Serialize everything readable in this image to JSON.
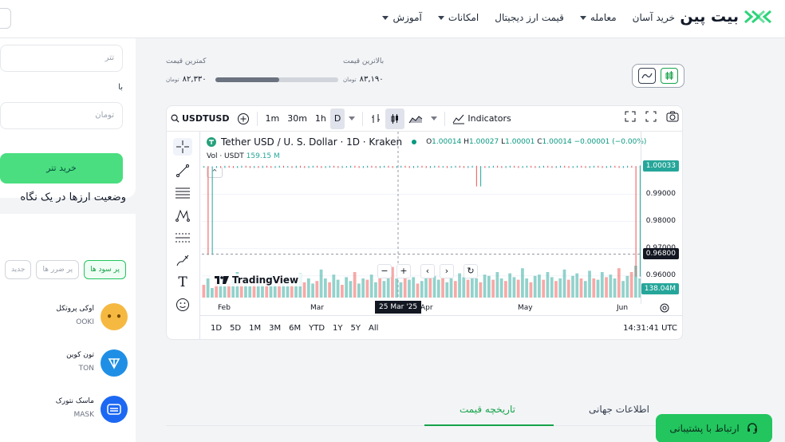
{
  "brand": {
    "name": "بیت پین",
    "logo_color": "#2dd47a"
  },
  "nav": {
    "items": [
      {
        "label": "خرید آسان",
        "has_caret": false
      },
      {
        "label": "معامله",
        "has_caret": true
      },
      {
        "label": "قیمت ارز دیجیتال",
        "has_caret": false
      },
      {
        "label": "امکانات",
        "has_caret": true
      },
      {
        "label": "آموزش",
        "has_caret": true
      }
    ]
  },
  "buy_form": {
    "crypto_placeholder": "تتر",
    "with_label": "با",
    "fiat_placeholder": "تومان",
    "buy_button": "خرید تتر"
  },
  "market_status": {
    "title": "وضعیت ارزها در یک نگاه",
    "filters": [
      "پر سود ها",
      "پر ضرر ها",
      "جدید"
    ],
    "active_filter": 0,
    "coins": [
      {
        "name": "اوکی پروتکل",
        "symbol": "OOKI",
        "icon": "ooki-icon",
        "color": "#f5b942"
      },
      {
        "name": "تون کوین",
        "symbol": "TON",
        "icon": "ton-icon",
        "color": "#1f8fe6"
      },
      {
        "name": "ماسک نتورک",
        "symbol": "MASK",
        "icon": "mask-icon",
        "color": "#1c68f3"
      }
    ]
  },
  "price_range": {
    "high_label": "بالاترین قیمت",
    "high_value": "۸۳,۱۹۰",
    "low_label": "کمترین قیمت",
    "low_value": "۸۲,۳۳۰",
    "unit": "تومان",
    "position": 0.52
  },
  "chart_widget": {
    "symbol": "USDTUSD",
    "intervals": [
      "1m",
      "30m",
      "1h",
      "D"
    ],
    "active_interval": "D",
    "indicators_label": "Indicators",
    "title": "Tether USD / U. S. Dollar · 1D · Kraken",
    "ohlc": {
      "o_label": "O",
      "o": "1.00014",
      "h_label": "H",
      "h": "1.00027",
      "l_label": "L",
      "l": "1.00001",
      "c_label": "C",
      "c": "1.00014",
      "chg": "−0.00001 (−0.00%)"
    },
    "volume_label": "Vol · USDT",
    "volume_value": "159.15 M",
    "last_price_tag": "1.00033",
    "crosshair_price_tag": "0.96800",
    "volume_tag": "138.04M",
    "crosshair_date": "25 Mar '25",
    "logo_text": "TradingView",
    "ranges": [
      "1D",
      "5D",
      "1M",
      "3M",
      "6M",
      "YTD",
      "1Y",
      "5Y",
      "All"
    ],
    "clock": "14:31:41 UTC",
    "accent_up": "#26a69a",
    "accent_down": "#ef5350"
  },
  "chart_data": {
    "type": "line",
    "ylim": [
      0.952,
      1.006
    ],
    "ytick_labels": [
      "1.00000",
      "0.99000",
      "0.98000",
      "0.97000",
      "0.96000"
    ],
    "ytick_values": [
      1.0,
      0.99,
      0.98,
      0.97,
      0.96
    ],
    "xtick_labels": [
      "Feb",
      "Mar",
      "Apr",
      "May",
      "Jun"
    ],
    "price_series": [
      1.0001,
      0.968,
      1.0,
      1.0001,
      1.0,
      1.0002,
      1.0001,
      1.0,
      1.0001,
      1.0002,
      1.0001,
      1.0,
      1.0001,
      1.0,
      1.0002,
      1.0001,
      1.0,
      1.0001,
      1.0002,
      1.0001,
      1.0001,
      1.0,
      1.0002,
      1.0001,
      1.0,
      1.0001,
      1.0002,
      1.0001,
      1.0,
      1.0001,
      1.0002,
      1.0001,
      1.0,
      1.0001,
      1.0001,
      1.0002,
      1.0001,
      1.0,
      1.0001,
      1.0002,
      1.0001,
      1.0,
      1.0001,
      1.0002,
      1.0001,
      1.0,
      1.0001,
      1.0002,
      1.0001,
      1.0,
      1.0001,
      1.0002,
      1.0001,
      1.0,
      1.0001,
      1.0002,
      1.0001,
      1.0001,
      1.0,
      1.0001,
      1.0002,
      1.0001,
      1.0,
      1.0001,
      1.0002,
      0.9932,
      1.0001,
      1.0,
      1.0001,
      1.0002,
      1.0001,
      1.0,
      1.0001,
      1.0002,
      1.0001,
      1.0,
      1.0001,
      1.0002,
      1.0001,
      1.0,
      1.0001,
      1.0002,
      1.0001,
      1.0,
      1.0001,
      1.0002,
      1.0001,
      1.0,
      1.0001,
      1.0002,
      1.0001,
      1.0,
      1.0001,
      1.0002,
      1.0001,
      1.0,
      1.0001,
      1.0002,
      1.0001,
      1.0,
      1.0001,
      1.0002,
      1.0001,
      0.96,
      1.0003
    ],
    "volume_series": [
      20,
      30,
      15,
      25,
      35,
      18,
      22,
      28,
      40,
      26,
      30,
      18,
      24,
      32,
      20,
      28,
      36,
      22,
      30,
      26,
      34,
      20,
      28,
      38,
      24,
      30,
      22,
      26,
      44,
      30,
      24,
      36,
      28,
      20,
      32,
      26,
      40,
      22,
      30,
      28,
      36,
      24,
      30,
      26,
      34,
      48,
      30,
      24,
      38,
      28,
      32,
      22,
      26,
      40,
      30,
      34,
      28,
      36,
      24,
      30,
      26,
      38,
      32,
      28,
      42,
      30,
      24,
      36,
      34,
      28,
      40,
      30,
      26,
      38,
      32,
      28,
      46,
      30,
      24,
      34,
      36,
      28,
      40,
      32,
      26,
      30,
      44,
      28,
      34,
      38,
      30,
      26,
      42,
      30,
      28,
      40,
      32,
      36,
      30,
      46,
      26,
      34,
      40,
      50,
      30
    ]
  },
  "tabs": [
    "اطلاعات جهانی",
    "تاریخچه قیمت"
  ],
  "active_tab": 1,
  "support_button": "ارتباط با پشتیبانی"
}
